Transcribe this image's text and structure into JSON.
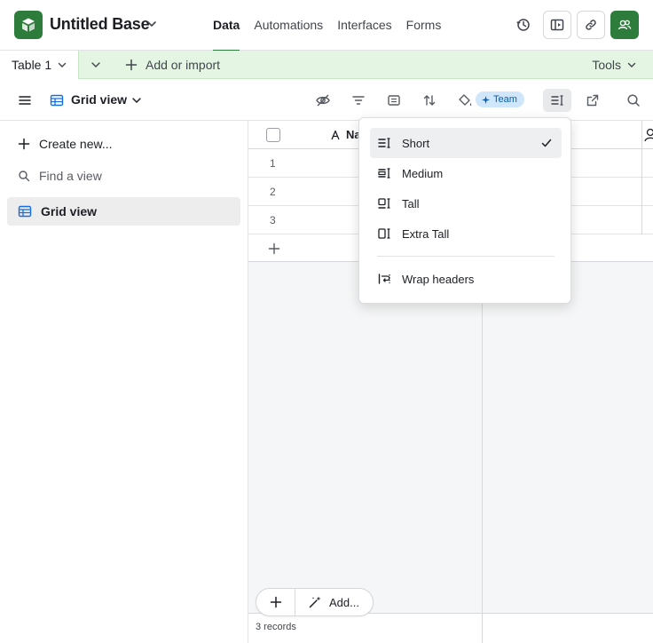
{
  "base": {
    "name": "Untitled Base"
  },
  "nav": {
    "tabs": [
      "Data",
      "Automations",
      "Interfaces",
      "Forms"
    ],
    "active": "Data"
  },
  "tabs": {
    "table_name": "Table 1",
    "add_label": "Add or import",
    "tools_label": "Tools"
  },
  "viewbar": {
    "view_name": "Grid view",
    "team_badge": "Team"
  },
  "sidebar": {
    "create_label": "Create new...",
    "find_placeholder": "Find a view",
    "items": [
      {
        "label": "Grid view",
        "selected": true
      }
    ]
  },
  "grid": {
    "first_column_header": "Na",
    "rows": [
      "1",
      "2",
      "3"
    ],
    "add_label": "Add...",
    "records_count": "3 records"
  },
  "row_height_menu": {
    "options": [
      {
        "label": "Short",
        "icon": "row-height-short-icon",
        "selected": true
      },
      {
        "label": "Medium",
        "icon": "row-height-medium-icon",
        "selected": false
      },
      {
        "label": "Tall",
        "icon": "row-height-tall-icon",
        "selected": false
      },
      {
        "label": "Extra Tall",
        "icon": "row-height-extra-tall-icon",
        "selected": false
      }
    ],
    "wrap_headers_label": "Wrap headers"
  },
  "colors": {
    "brand_green": "#2d7c3b",
    "tab_bar_bg": "#e4f6e3",
    "team_badge_bg": "#cfe6fb"
  }
}
